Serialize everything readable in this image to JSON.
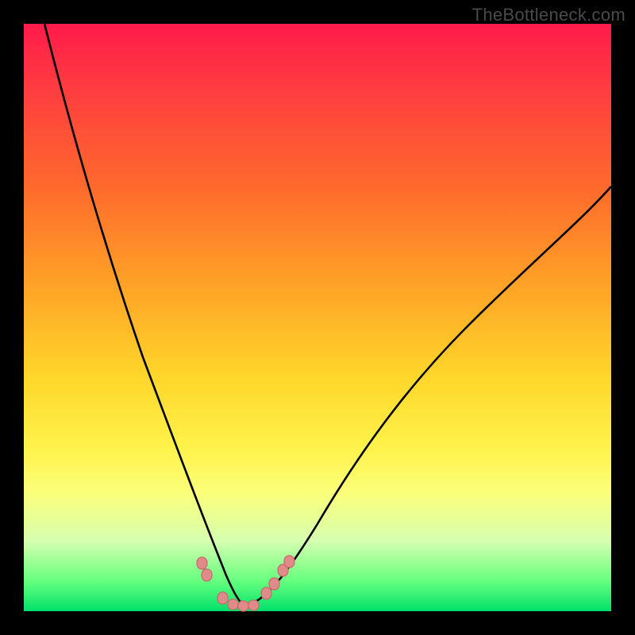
{
  "watermark": "TheBottleneck.com",
  "colors": {
    "curve_stroke": "#000000",
    "marker_fill": "#e08a8a",
    "marker_stroke": "#c86a6a",
    "frame": "#000000"
  },
  "chart_data": {
    "type": "line",
    "title": "",
    "xlabel": "",
    "ylabel": "",
    "xlim": [
      0,
      100
    ],
    "ylim": [
      0,
      100
    ],
    "series": [
      {
        "name": "left-branch",
        "x": [
          3.5,
          5,
          8,
          12,
          16,
          20,
          24,
          27,
          30,
          32,
          33.5,
          35,
          36
        ],
        "y": [
          100,
          88,
          70,
          53,
          40,
          29,
          20,
          13.5,
          8,
          5,
          3.2,
          1.7,
          1
        ]
      },
      {
        "name": "right-branch",
        "x": [
          36,
          38,
          41,
          45,
          50,
          56,
          63,
          72,
          84,
          100
        ],
        "y": [
          1,
          1.5,
          3.6,
          8,
          14,
          21,
          29,
          38,
          50,
          63
        ]
      }
    ],
    "markers": [
      {
        "series": "left-branch",
        "x": 30.1,
        "y": 8.0
      },
      {
        "series": "left-branch",
        "x": 30.9,
        "y": 6.1
      },
      {
        "series": "left-branch",
        "x": 33.5,
        "y": 2.1
      },
      {
        "series": "left-branch",
        "x": 35.3,
        "y": 1.05
      },
      {
        "series": "left-branch",
        "x": 37.0,
        "y": 0.85
      },
      {
        "series": "left-branch",
        "x": 38.7,
        "y": 0.95
      },
      {
        "series": "right-branch",
        "x": 41.0,
        "y": 3.0
      },
      {
        "series": "right-branch",
        "x": 42.4,
        "y": 4.5
      },
      {
        "series": "right-branch",
        "x": 44.0,
        "y": 7.0
      },
      {
        "series": "right-branch",
        "x": 45.0,
        "y": 8.4
      }
    ]
  }
}
